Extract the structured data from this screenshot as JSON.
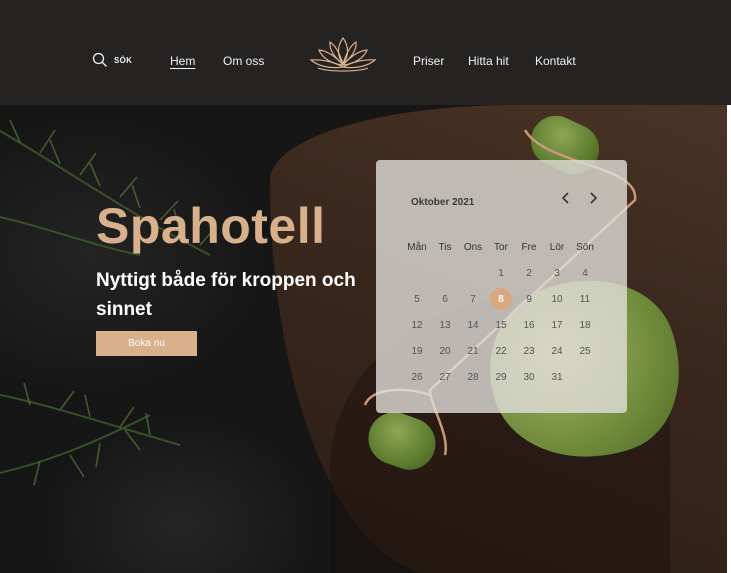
{
  "nav": {
    "search_label": "SÖK",
    "items": [
      {
        "label": "Hem",
        "active": true
      },
      {
        "label": "Om oss",
        "active": false
      },
      {
        "label": "Priser",
        "active": false
      },
      {
        "label": "Hitta hit",
        "active": false
      },
      {
        "label": "Kontakt",
        "active": false
      }
    ],
    "logo_icon": "lotus-logo-icon"
  },
  "hero": {
    "title": "Spahotell",
    "subtitle": "Nyttigt både för kroppen och sinnet",
    "cta_label": "Boka nu"
  },
  "calendar": {
    "month_label": "Oktober 2021",
    "weekdays": [
      "Mån",
      "Tis",
      "Ons",
      "Tor",
      "Fre",
      "Lör",
      "Sön"
    ],
    "weeks": [
      [
        "",
        "",
        "",
        "",
        "1",
        "2",
        "3",
        "4"
      ],
      [
        "5",
        "6",
        "7",
        "8",
        "9",
        "10",
        "11"
      ],
      [
        "12",
        "13",
        "14",
        "15",
        "16",
        "17",
        "18"
      ],
      [
        "19",
        "20",
        "21",
        "22",
        "23",
        "24",
        "25"
      ],
      [
        "26",
        "27",
        "28",
        "29",
        "30",
        "31",
        ""
      ]
    ],
    "selected_day": "8"
  },
  "colors": {
    "accent": "#d8b08c",
    "topbar": "#252322",
    "selected": "#d9a880"
  }
}
